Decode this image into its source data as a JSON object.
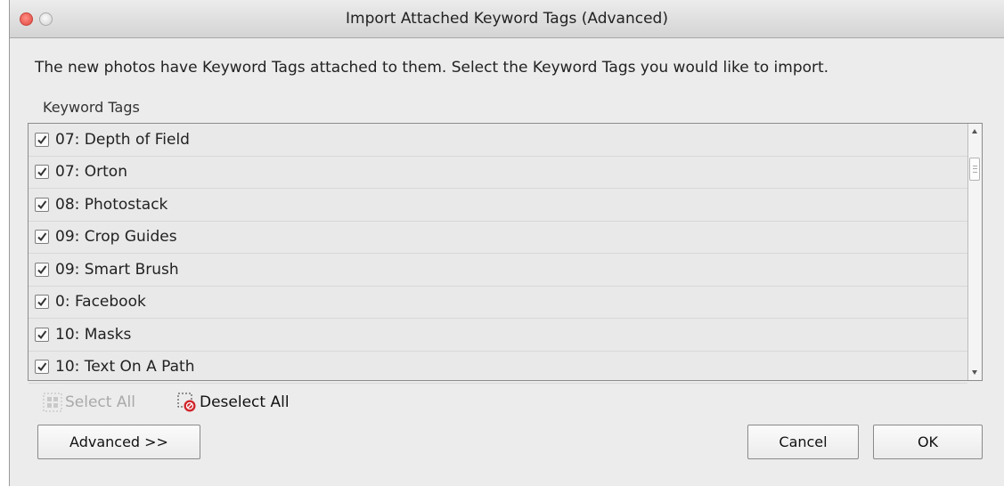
{
  "window": {
    "title": "Import Attached Keyword Tags (Advanced)"
  },
  "intro_text": "The new photos have Keyword Tags attached to them.  Select the Keyword Tags you would like to import.",
  "list": {
    "label": "Keyword Tags",
    "items": [
      {
        "label": "07: Depth of Field",
        "checked": true
      },
      {
        "label": "07: Orton",
        "checked": true
      },
      {
        "label": "08: Photostack",
        "checked": true
      },
      {
        "label": "09: Crop Guides",
        "checked": true
      },
      {
        "label": "09: Smart Brush",
        "checked": true
      },
      {
        "label": "0: Facebook",
        "checked": true
      },
      {
        "label": "10: Masks",
        "checked": true
      },
      {
        "label": "10: Text On A Path",
        "checked": true
      }
    ]
  },
  "actions": {
    "select_all": "Select All",
    "deselect_all": "Deselect All"
  },
  "buttons": {
    "advanced": "Advanced >>",
    "cancel": "Cancel",
    "ok": "OK"
  },
  "icons": {
    "close": "close-icon",
    "minimize": "minimize-icon",
    "checkbox": "checkmark-icon",
    "select_all": "select-all-icon",
    "deselect_all": "deselect-all-icon"
  },
  "colors": {
    "close_button": "#e0443b",
    "disabled_text": "#a9a9a9",
    "deselect_badge": "#d0252b"
  }
}
